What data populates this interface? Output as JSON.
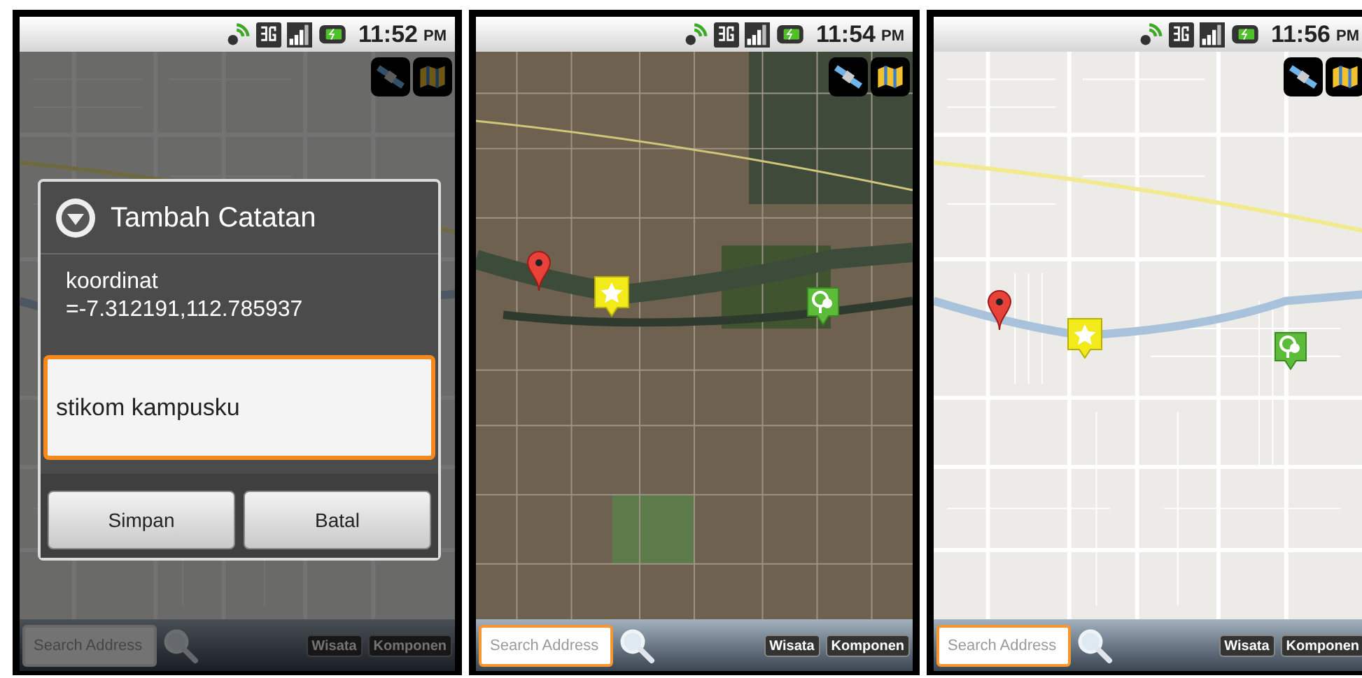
{
  "screens": [
    {
      "time": "11:52",
      "ampm": "PM",
      "map": {
        "kind": "street"
      },
      "dimmed": true,
      "dialog": {
        "title": "Tambah Catatan",
        "message_lines": [
          "koordinat",
          "=-7.312191,112.785937"
        ],
        "input_value": "stikom kampusku",
        "buttons": [
          "Simpan",
          "Batal"
        ]
      },
      "search": {
        "placeholder": "Search Address",
        "focused": false
      },
      "bar_buttons": [
        "Wisata",
        "Komponen"
      ]
    },
    {
      "time": "11:54",
      "ampm": "PM",
      "map": {
        "kind": "satellite"
      },
      "dimmed": false,
      "markers": [
        {
          "kind": "pin"
        },
        {
          "kind": "star"
        },
        {
          "kind": "tree"
        }
      ],
      "search": {
        "placeholder": "Search Address",
        "focused": true
      },
      "bar_buttons": [
        "Wisata",
        "Komponen"
      ]
    },
    {
      "time": "11:56",
      "ampm": "PM",
      "map": {
        "kind": "street"
      },
      "dimmed": false,
      "markers": [
        {
          "kind": "pin"
        },
        {
          "kind": "star"
        },
        {
          "kind": "tree"
        }
      ],
      "search": {
        "placeholder": "Search Address",
        "focused": true
      },
      "bar_buttons": [
        "Wisata",
        "Komponen"
      ]
    }
  ]
}
